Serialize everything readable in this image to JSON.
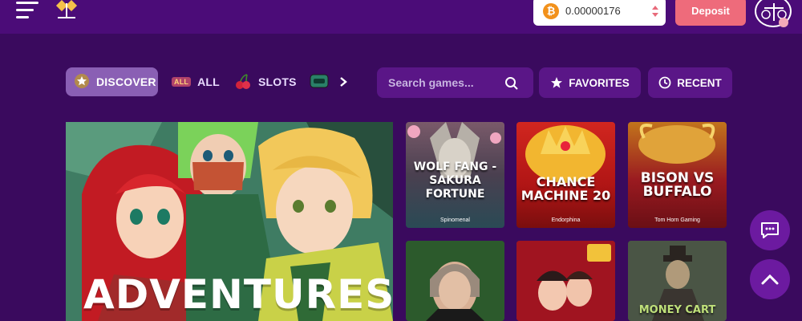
{
  "header": {
    "wallet": {
      "currency_symbol": "₿",
      "amount": "0.00000176"
    },
    "deposit_label": "Deposit"
  },
  "tabs": [
    {
      "label": "DISCOVER",
      "icon": "star-badge-icon",
      "active": true
    },
    {
      "label": "ALL",
      "badge": "ALL"
    },
    {
      "label": "SLOTS",
      "icon": "cherry-icon"
    },
    {
      "label": "",
      "icon": "game-thumb-icon"
    }
  ],
  "search": {
    "placeholder": "Search games..."
  },
  "buttons": {
    "favorites": "FAVORITES",
    "recent": "RECENT"
  },
  "hero": {
    "title": "ADVENTURES"
  },
  "games": [
    {
      "title": "WOLF FANG -\nSAKURA\nFORTUNE",
      "provider": "Spinomenal"
    },
    {
      "title": "CHANCE\nMACHINE 20",
      "provider": "Endorphina"
    },
    {
      "title": "BISON VS\nBUFFALO",
      "provider": "Tom Horn Gaming"
    },
    {
      "title": "",
      "provider": ""
    },
    {
      "title": "",
      "provider": ""
    },
    {
      "title": "MONEY CART",
      "provider": ""
    }
  ],
  "colors": {
    "background": "#3a0a5e",
    "topbar": "#4b0c78",
    "deposit": "#ee6b7b",
    "accent": "#5a1687"
  }
}
